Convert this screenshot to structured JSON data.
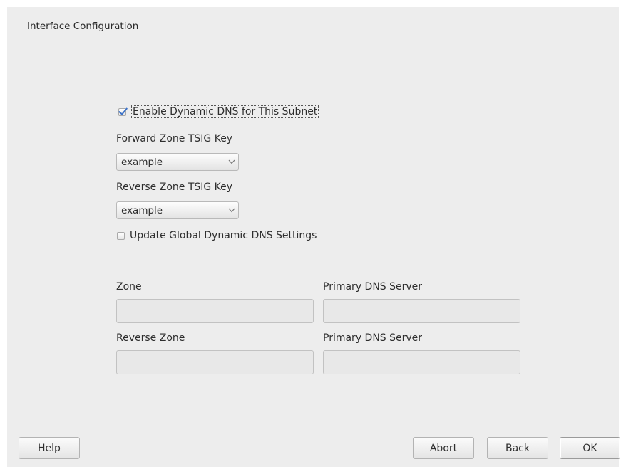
{
  "window": {
    "title": "Interface Configuration"
  },
  "ddns": {
    "enable_label": "Enable Dynamic DNS for This Subnet",
    "enable_checked": true,
    "forward_key_label": "Forward Zone TSIG Key",
    "forward_key_value": "example",
    "reverse_key_label": "Reverse Zone TSIG Key",
    "reverse_key_value": "example",
    "update_global_label": "Update Global Dynamic DNS Settings",
    "update_global_checked": false
  },
  "zones": {
    "zone_label": "Zone",
    "zone_value": "",
    "zone_primary_label": "Primary DNS Server",
    "zone_primary_value": "",
    "reverse_zone_label": "Reverse Zone",
    "reverse_zone_value": "",
    "reverse_primary_label": "Primary DNS Server",
    "reverse_primary_value": ""
  },
  "buttons": {
    "help": "Help",
    "abort": "Abort",
    "back": "Back",
    "ok": "OK"
  },
  "icons": {
    "check": "checkmark-icon",
    "dropdown": "chevron-down-icon"
  },
  "colors": {
    "background": "#ededed",
    "check_accent": "#3d73c8"
  }
}
